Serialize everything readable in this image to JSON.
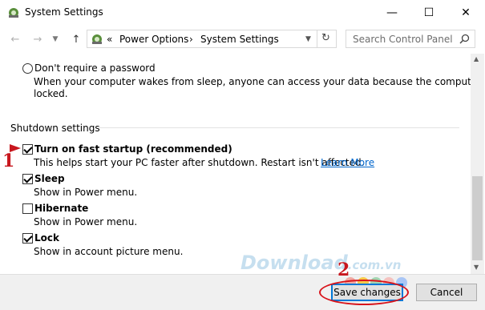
{
  "window": {
    "title": "System Settings",
    "minimize": "—",
    "maximize": "☐",
    "close": "✕"
  },
  "address": {
    "breadcrumbs": [
      "«",
      "Power Options",
      "›",
      "System Settings"
    ],
    "search_placeholder": "Search Control Panel"
  },
  "options": {
    "no_password": {
      "label": "Don't require a password",
      "desc_line1": "When your computer wakes from sleep, anyone can access your data because the computer isn't",
      "desc_line2": "locked."
    },
    "shutdown_header": "Shutdown settings",
    "items": [
      {
        "label": "Turn on fast startup (recommended)",
        "desc": "This helps start your PC faster after shutdown. Restart isn't affected.",
        "link": "Learn More",
        "checked": true
      },
      {
        "label": "Sleep",
        "desc": "Show in Power menu.",
        "checked": true
      },
      {
        "label": "Hibernate",
        "desc": "Show in Power menu.",
        "checked": false
      },
      {
        "label": "Lock",
        "desc": "Show in account picture menu.",
        "checked": true
      }
    ]
  },
  "annotations": {
    "marker1": "1",
    "marker2": "2"
  },
  "watermark": {
    "main": "Download",
    "suffix": ".com.vn"
  },
  "footer": {
    "save_label": "Save changes",
    "cancel_label": "Cancel"
  },
  "colors": {
    "accent": "#0078d7",
    "annotation_red": "#d8141b",
    "link": "#0066cc"
  }
}
